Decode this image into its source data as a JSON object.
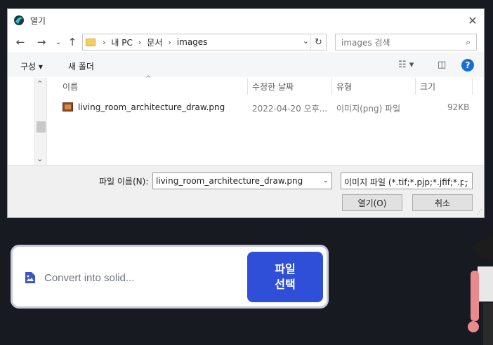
{
  "window": {
    "title": "열기"
  },
  "nav": {
    "breadcrumb": [
      "내 PC",
      "문서",
      "images"
    ],
    "search_placeholder": "images 검색"
  },
  "toolbar": {
    "organize_label": "구성",
    "new_folder_label": "새 폴더"
  },
  "columns": {
    "name": "이름",
    "modified": "수정한 날짜",
    "type": "유형",
    "size": "크기"
  },
  "files": [
    {
      "name": "living_room_architecture_draw.png",
      "modified": "2022-04-20 오후...",
      "type": "이미지(png) 파일",
      "size": "92KB"
    }
  ],
  "footer": {
    "filename_label": "파일 이름(N):",
    "filename_value": "living_room_architecture_draw.png",
    "filetype_value": "이미지 파일 (*.tif;*.pjp;*.jfif;*.pj",
    "open_label": "열기(O)",
    "cancel_label": "취소"
  },
  "card": {
    "placeholder": "Convert into solid...",
    "button_line1": "파일",
    "button_line2": "선택"
  },
  "colors": {
    "accent": "#2f4fd8",
    "background": "#181a22",
    "help": "#1a6ed0"
  }
}
